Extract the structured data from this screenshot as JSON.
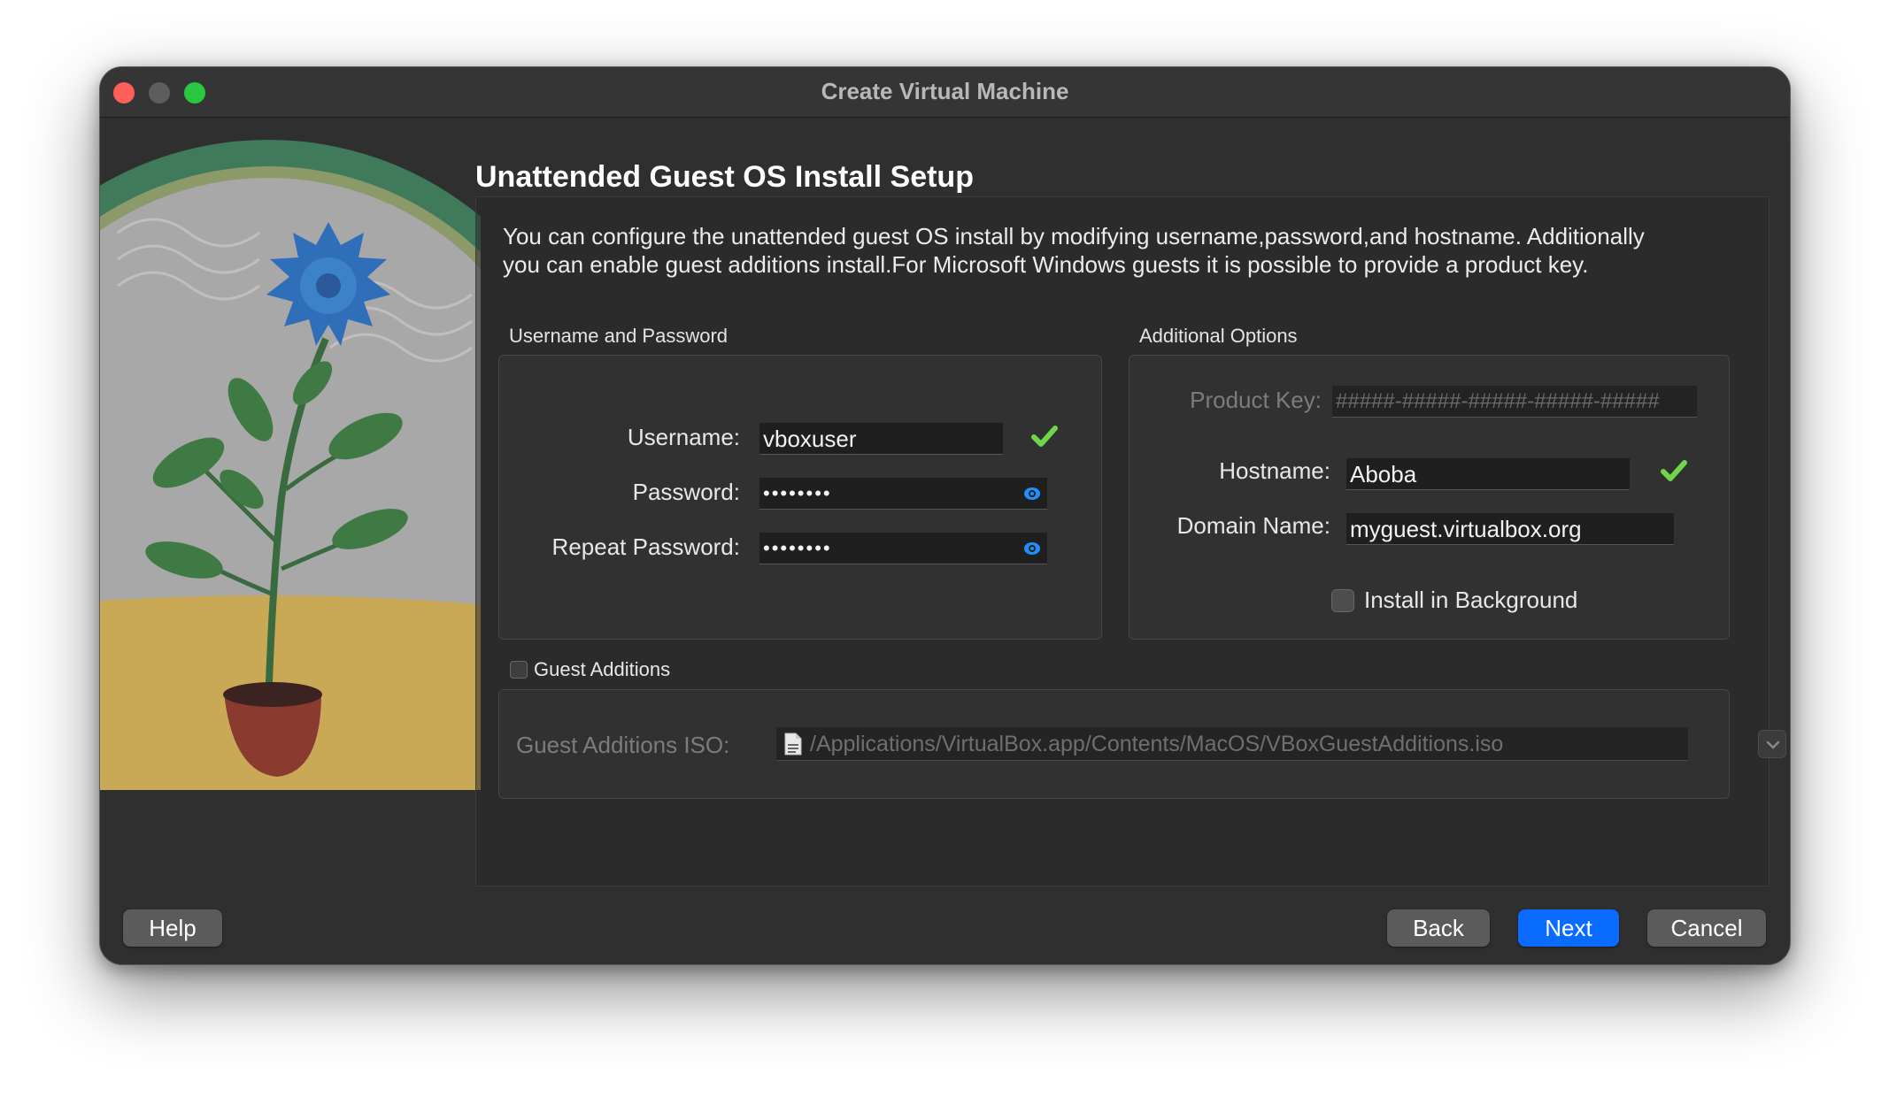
{
  "window": {
    "title": "Create Virtual Machine"
  },
  "page": {
    "title": "Unattended Guest OS Install Setup",
    "description": "You can configure the unattended guest OS install by modifying username,password,and hostname. Additionally you can enable guest additions install.For Microsoft Windows guests it is possible to provide a product key."
  },
  "credentials": {
    "section_label": "Username and Password",
    "username_label": "Username:",
    "username_value": "vboxuser",
    "password_label": "Password:",
    "password_value": "••••••••",
    "repeat_password_label": "Repeat Password:",
    "repeat_password_value": "••••••••"
  },
  "options": {
    "section_label": "Additional Options",
    "product_key_label": "Product Key:",
    "product_key_value": "#####-#####-#####-#####-#####",
    "hostname_label": "Hostname:",
    "hostname_value": "Aboba",
    "domain_label": "Domain Name:",
    "domain_value": "myguest.virtualbox.org",
    "install_background_label": "Install in Background",
    "install_background_checked": false
  },
  "guest_additions": {
    "checkbox_label": "Guest Additions",
    "checked": false,
    "iso_label": "Guest Additions ISO:",
    "iso_path": "/Applications/VirtualBox.app/Contents/MacOS/VBoxGuestAdditions.iso"
  },
  "buttons": {
    "help": "Help",
    "back": "Back",
    "next": "Next",
    "cancel": "Cancel"
  },
  "colors": {
    "accent": "#0a6cff",
    "valid_check": "#6fd64a",
    "close": "#fe5f57",
    "maximize": "#28c840"
  },
  "icons": {
    "username_status": "checkmark-icon",
    "hostname_status": "checkmark-icon",
    "password_toggle": "eye-icon",
    "iso_file": "document-icon",
    "combo_arrow": "chevron-down-icon"
  }
}
